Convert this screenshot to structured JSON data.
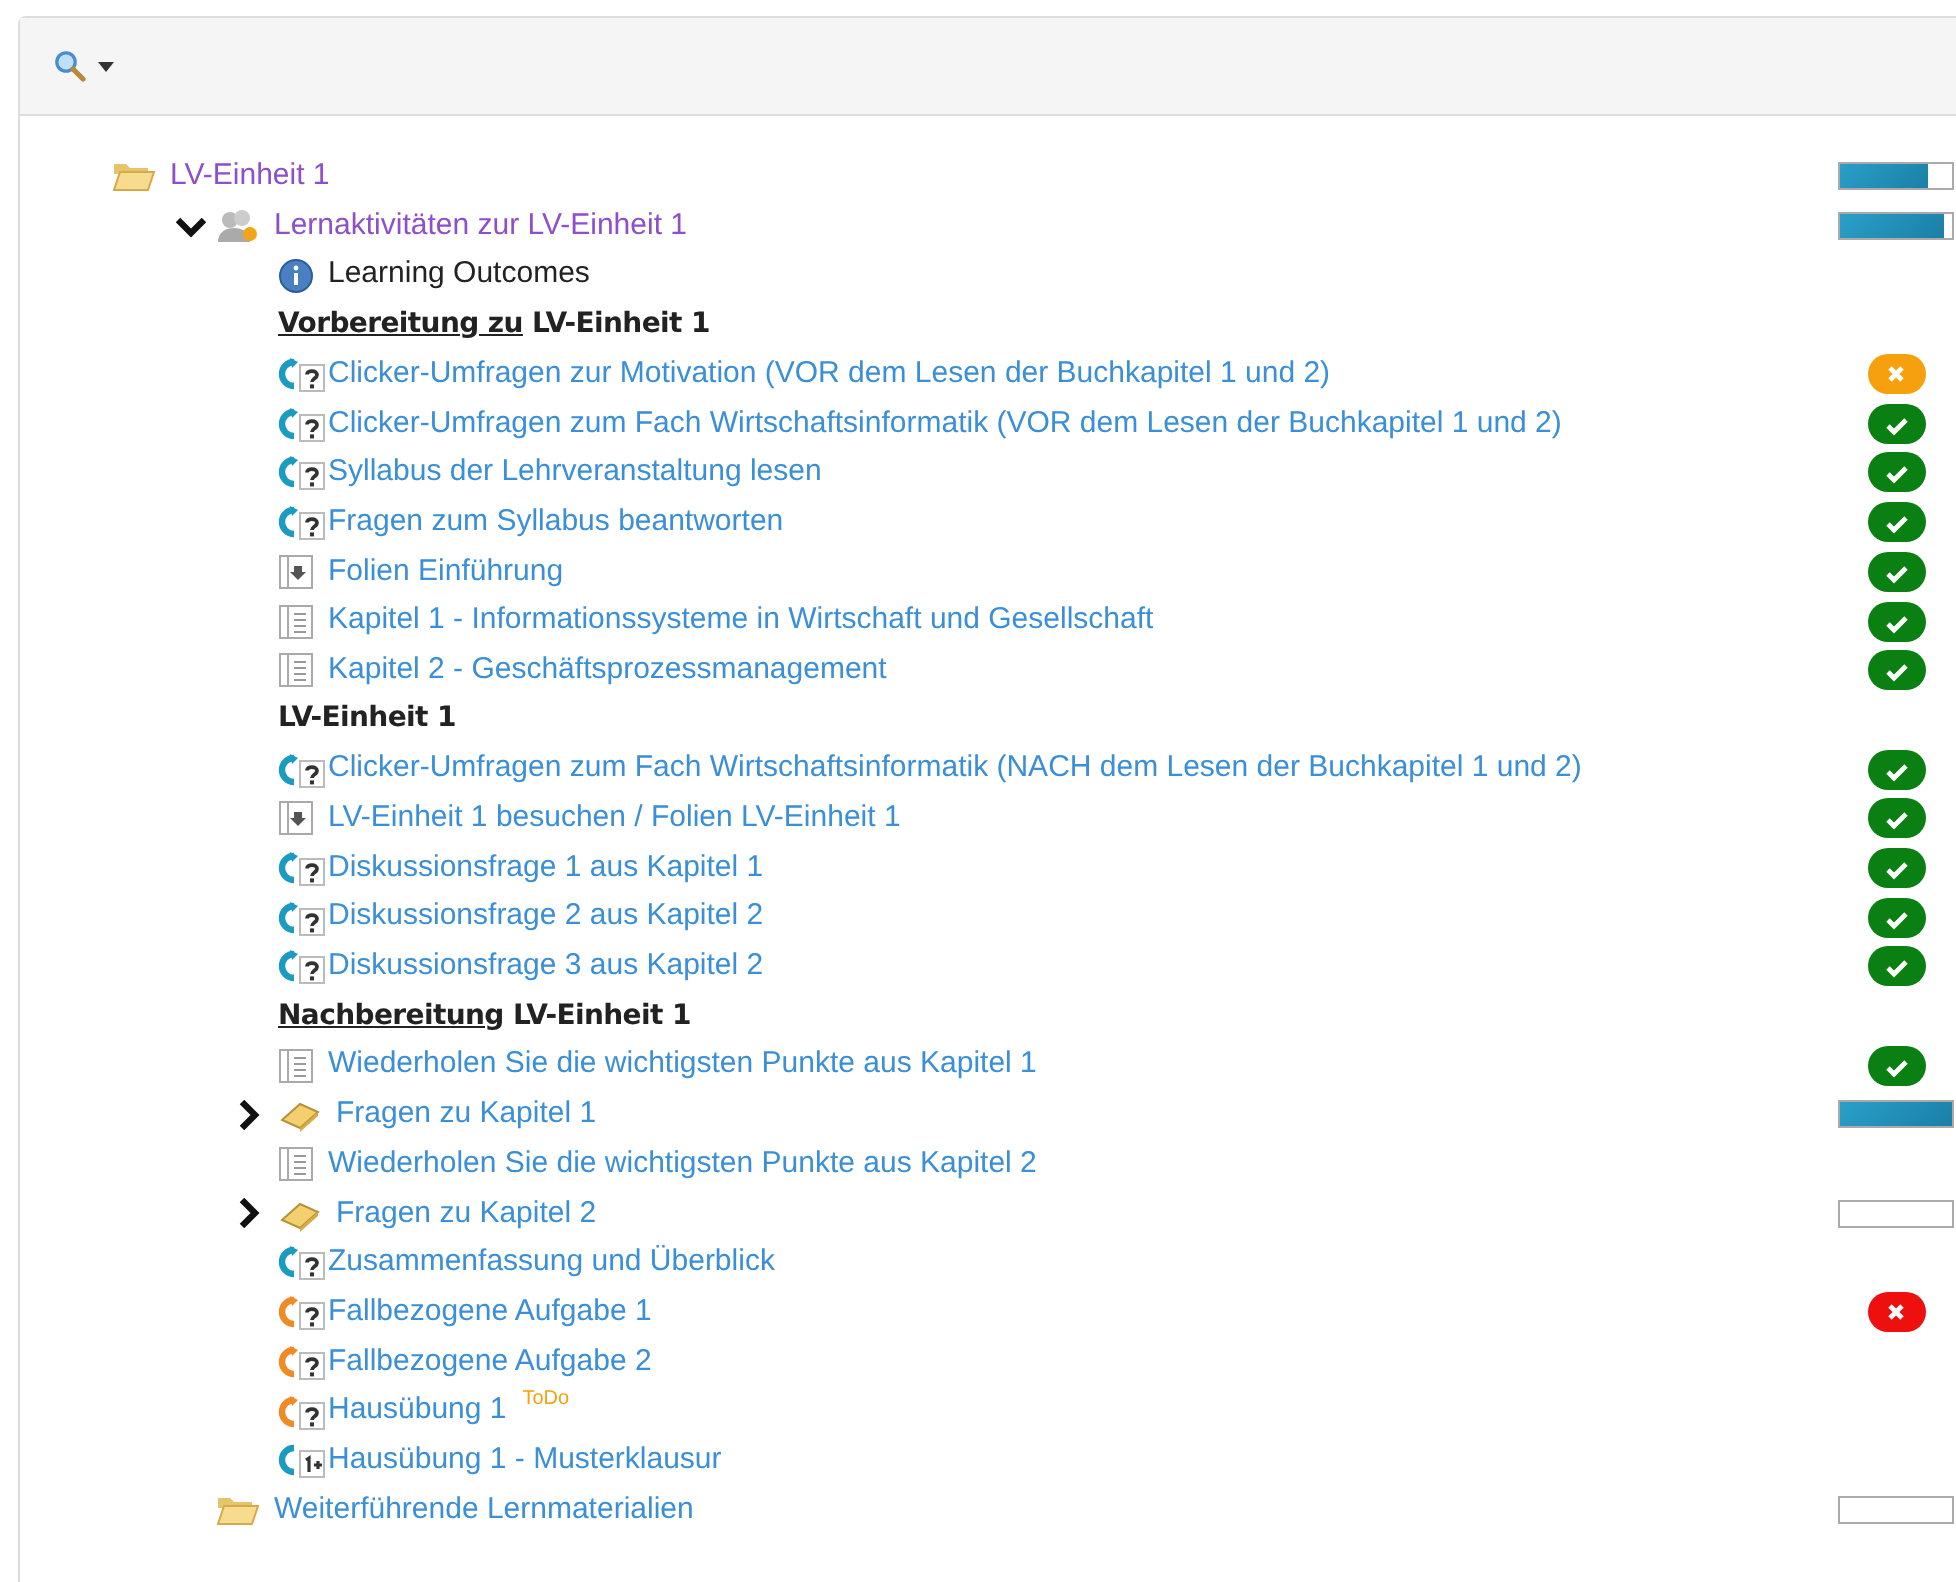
{
  "tree": [
    {
      "kind": "folder",
      "label": "LV-Einheit 1",
      "visited": true,
      "progress": {
        "level": 0.78
      },
      "children": [
        {
          "kind": "group",
          "label": "Lernaktivitäten zur LV-Einheit 1",
          "visited": true,
          "expanded": true,
          "progress": {
            "level": 0.93
          },
          "children": [
            {
              "kind": "info",
              "label": "Learning Outcomes"
            },
            {
              "kind": "heading",
              "underlined": "Vorbereitung zu",
              "text": "LV-Einheit 1"
            },
            {
              "kind": "survey",
              "label": "Clicker-Umfragen zur Motivation (VOR dem Lesen der Buchkapitel 1 und 2)",
              "visited": false,
              "done": false,
              "failed": false
            },
            {
              "kind": "survey",
              "label": "Clicker-Umfragen zum Fach Wirtschaftsinformatik (VOR dem Lesen der Buchkapitel 1 und 2)",
              "visited": false,
              "done": true,
              "failed": false
            },
            {
              "kind": "survey",
              "label": "Syllabus der Lehrveranstaltung lesen",
              "visited": false,
              "done": true,
              "failed": false
            },
            {
              "kind": "survey",
              "label": "Fragen zum Syllabus beantworten",
              "visited": false,
              "done": true,
              "failed": false
            },
            {
              "kind": "file",
              "label": "Folien Einführung",
              "visited": false,
              "done": true,
              "failed": false
            },
            {
              "kind": "page",
              "label": "Kapitel 1 - Informationssysteme in Wirtschaft und Gesellschaft",
              "visited": false,
              "done": true,
              "failed": false
            },
            {
              "kind": "page",
              "label": "Kapitel 2 - Geschäftsprozessmanagement",
              "visited": false,
              "done": true,
              "failed": false
            },
            {
              "kind": "heading",
              "text": "LV-Einheit 1"
            },
            {
              "kind": "survey",
              "label": "Clicker-Umfragen zum Fach Wirtschaftsinformatik (NACH dem Lesen der Buchkapitel 1 und 2)",
              "visited": false,
              "done": true,
              "failed": false
            },
            {
              "kind": "file",
              "label": "LV-Einheit 1 besuchen / Folien LV-Einheit 1",
              "visited": false,
              "done": true,
              "failed": false
            },
            {
              "kind": "survey",
              "label": "Diskussionsfrage 1 aus Kapitel 1",
              "visited": false,
              "done": true,
              "failed": false
            },
            {
              "kind": "survey",
              "label": "Diskussionsfrage 2 aus Kapitel 2",
              "visited": false,
              "done": true,
              "failed": false
            },
            {
              "kind": "survey",
              "label": "Diskussionsfrage 3 aus Kapitel 2",
              "visited": false,
              "done": true,
              "failed": false
            },
            {
              "kind": "heading",
              "underlined": "Nachbereitung",
              "text": "LV-Einheit 1"
            },
            {
              "kind": "page",
              "label": "Wiederholen Sie die wichtigsten Punkte aus Kapitel 1",
              "visited": false,
              "done": true,
              "failed": false
            },
            {
              "kind": "test",
              "label": "Fragen zu Kapitel 1",
              "visited": false,
              "expanded": false,
              "progress": {
                "level": 1
              }
            },
            {
              "kind": "page",
              "label": "Wiederholen Sie die wichtigsten Punkte aus Kapitel 2",
              "visited": false
            },
            {
              "kind": "test",
              "label": "Fragen zu Kapitel 2",
              "visited": false,
              "expanded": false,
              "progress": {
                "level": 0
              }
            },
            {
              "kind": "survey",
              "label": "Zusammenfassung und Überblick",
              "visited": false
            },
            {
              "kind": "assignment",
              "label": "Fallbezogene Aufgabe 1",
              "visited": false,
              "done": false,
              "failed": true
            },
            {
              "kind": "assignment",
              "label": "Fallbezogene Aufgabe 2",
              "visited": false
            },
            {
              "kind": "assignment",
              "label": "Hausübung 1",
              "visited": false,
              "tag": "ToDo"
            },
            {
              "kind": "exam",
              "label": "Hausübung 1 - Musterklausur",
              "visited": false
            }
          ]
        },
        {
          "kind": "folder",
          "label": "Weiterführende Lernmaterialien",
          "visited": false,
          "progress": {
            "level": 0
          }
        }
      ]
    }
  ]
}
